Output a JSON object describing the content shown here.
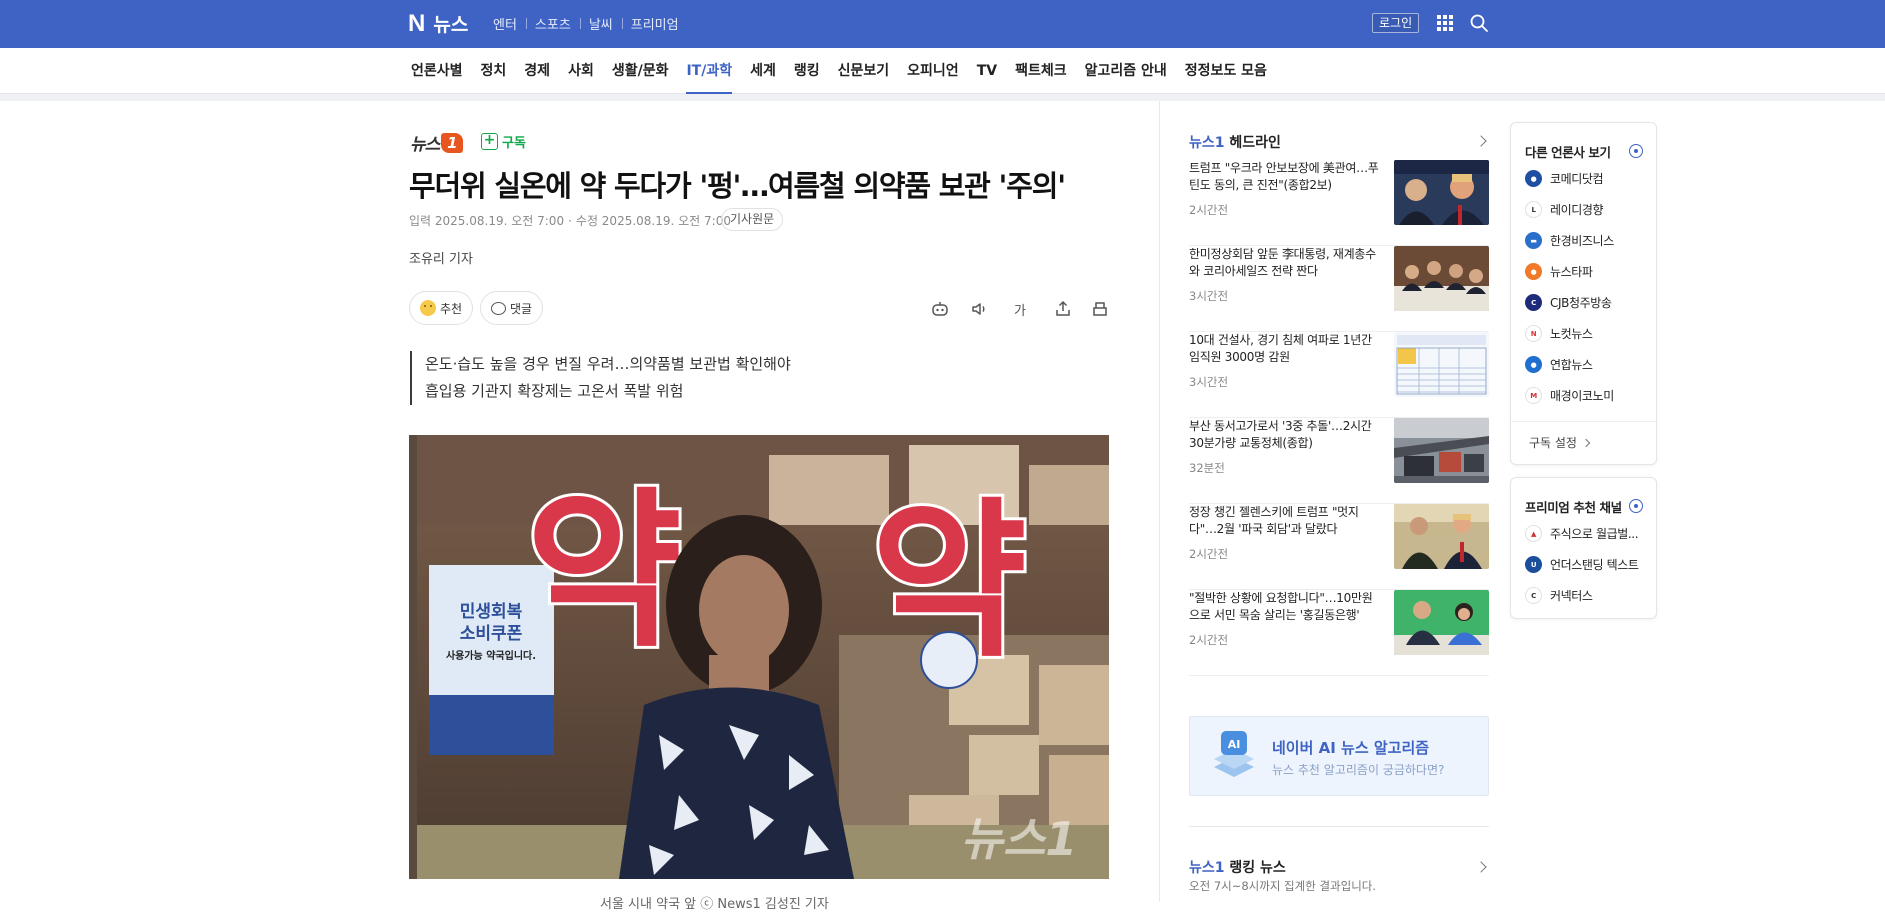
{
  "topbar": {
    "logo": "N",
    "brand_name": "뉴스",
    "service_links": [
      "엔터",
      "스포츠",
      "날씨",
      "프리미엄"
    ],
    "login_label": "로그인"
  },
  "category_nav": {
    "items": [
      "언론사별",
      "정치",
      "경제",
      "사회",
      "생활/문화",
      "IT/과학",
      "세계",
      "랭킹",
      "신문보기",
      "오피니언",
      "TV",
      "팩트체크",
      "알고리즘 안내",
      "정정보도 모음"
    ],
    "active": "IT/과학"
  },
  "article": {
    "press_logo_text": "뉴스",
    "press_logo_mark": "1",
    "subscribe_label": "구독",
    "headline": "무더위 실온에 약 두다가 '펑'…여름철 의약품 보관 '주의'",
    "input_date": "입력 2025.08.19. 오전 7:00",
    "edit_date": "수정 2025.08.19. 오전 7:00",
    "original_label": "기사원문",
    "byline": "조유리 기자",
    "recommend_label": "추천",
    "comment_label": "댓글",
    "font_tool_label": "가",
    "summary": [
      "온도·습도 높을 경우 변질 우려…의약품별 보관법 확인해야",
      "흡입용 기관지 확장제는 고온서 폭발 위험"
    ],
    "photo": {
      "sign_char": "약",
      "poster_title_1": "민생회복",
      "poster_title_2": "소비쿠폰",
      "poster_sub": "사용가능 약국입니다.",
      "watermark": "뉴스1"
    },
    "caption": "서울 시내 약국 앞 ⓒ News1 김성진 기자"
  },
  "headlines": {
    "press": "뉴스1",
    "title": "헤드라인",
    "items": [
      {
        "title": "트럼프 \"우크라 안보보장에 美관여…푸틴도 동의, 큰 진전\"(종합2보)",
        "time": "2시간전"
      },
      {
        "title": "한미정상회담 앞둔 李대통령, 재계총수와 코리아세일즈 전략 짠다",
        "time": "3시간전"
      },
      {
        "title": "10대 건설사, 경기 침체 여파로 1년간 임직원 3000명 감원",
        "time": "3시간전"
      },
      {
        "title": "부산 동서고가로서 '3중 추돌'…2시간 30분가량 교통정체(종합)",
        "time": "32분전"
      },
      {
        "title": "정장 챙긴 젤렌스키에 트럼프 \"멋지다\"…2월 '파국 회담'과 달랐다",
        "time": "2시간전"
      },
      {
        "title": "\"절박한 상황에 요청합니다\"…10만원으로 서민 목숨 살리는 '홍길동은행'",
        "time": "2시간전"
      }
    ]
  },
  "ai_banner": {
    "title": "네이버 AI 뉴스 알고리즘",
    "subtitle": "뉴스 추천 알고리즘이 궁금하다면?",
    "icon_text": "AI"
  },
  "ranking": {
    "press": "뉴스1",
    "title": "랭킹 뉴스",
    "subtitle": "오전 7시~8시까지 집계한 결과입니다."
  },
  "other_press": {
    "title": "다른 언론사 보기",
    "items": [
      {
        "name": "코메디닷컴",
        "color": "#1f4fa3"
      },
      {
        "name": "레이디경향",
        "color": "#ffffff"
      },
      {
        "name": "한경비즈니스",
        "color": "#2a6fc9"
      },
      {
        "name": "뉴스타파",
        "color": "#f07a2a"
      },
      {
        "name": "CJB청주방송",
        "color": "#1e2a7a"
      },
      {
        "name": "노컷뉴스",
        "color": "#ffffff"
      },
      {
        "name": "연합뉴스",
        "color": "#1f6fd1"
      },
      {
        "name": "매경이코노미",
        "color": "#ffffff"
      }
    ],
    "footer": "구독 설정"
  },
  "premium": {
    "title": "프리미엄 추천 채널",
    "items": [
      {
        "name": "주식으로 월급벌...",
        "color": "#ffffff"
      },
      {
        "name": "언더스탠딩 텍스트",
        "color": "#1b4f9c"
      },
      {
        "name": "커넥터스",
        "color": "#ffffff"
      }
    ]
  },
  "colors": {
    "brand_blue": "#3e63c4",
    "subscribe_green": "#11a84a",
    "news1_orange": "#e8561f"
  }
}
